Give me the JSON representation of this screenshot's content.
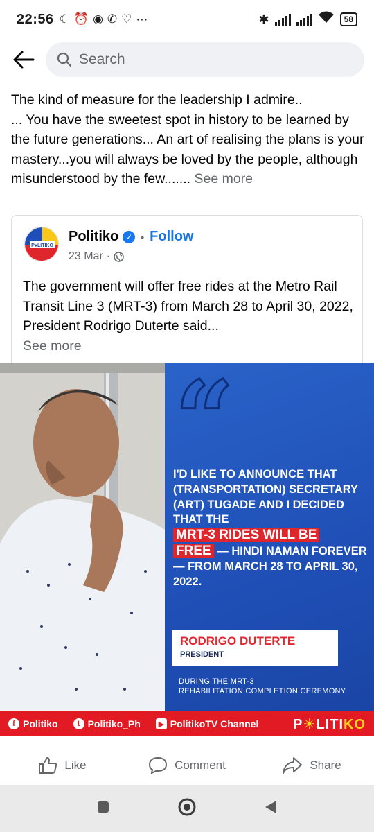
{
  "status_bar": {
    "time": "22:56",
    "battery": "58"
  },
  "search": {
    "placeholder": "Search"
  },
  "post": {
    "text": "The kind of measure for the leadership I admire..\n...  You have the sweetest spot in history to be learned by the future generations... An art of realising the plans is your mastery...you will always be loved by the people, although misunderstood by the few.......",
    "see_more": "See more"
  },
  "shared": {
    "page_name": "Politiko",
    "follow_label": "Follow",
    "date": "23 Mar",
    "text": "The government will offer free rides at the Metro Rail Transit Line 3 (MRT-3) from March 28 to April 30, 2022, President Rodrigo Duterte said...",
    "see_more": "See more"
  },
  "image": {
    "quote_before": "I'D LIKE TO ANNOUNCE THAT (TRANSPORTATION) SECRETARY (ART) TUGADE AND I DECIDED THAT THE",
    "quote_highlight_1": "MRT-3 RIDES WILL BE",
    "quote_highlight_2": "FREE",
    "quote_after": "— HINDI NAMAN FOREVER — FROM MARCH 28 TO APRIL 30, 2022.",
    "speaker_name": "RODRIGO DUTERTE",
    "speaker_title": "PRESIDENT",
    "ceremony_line1": "DURING THE MRT-3",
    "ceremony_line2": "REHABILITATION COMPLETION CEREMONY",
    "social": {
      "facebook": "Politiko",
      "twitter": "Politiko_Ph",
      "youtube": "PolitikoTV Channel",
      "brand_left": "P",
      "brand_mid": "LITI",
      "brand_right": "KO"
    },
    "accent_red": "#e21a23",
    "accent_blue": "#2a63c9"
  },
  "actions": {
    "like": "Like",
    "comment": "Comment",
    "share": "Share"
  },
  "icons": [
    "back-arrow-icon",
    "search-icon",
    "verified-icon",
    "globe-icon",
    "like-icon",
    "comment-icon",
    "share-icon",
    "recents-icon",
    "home-icon",
    "back-icon"
  ]
}
